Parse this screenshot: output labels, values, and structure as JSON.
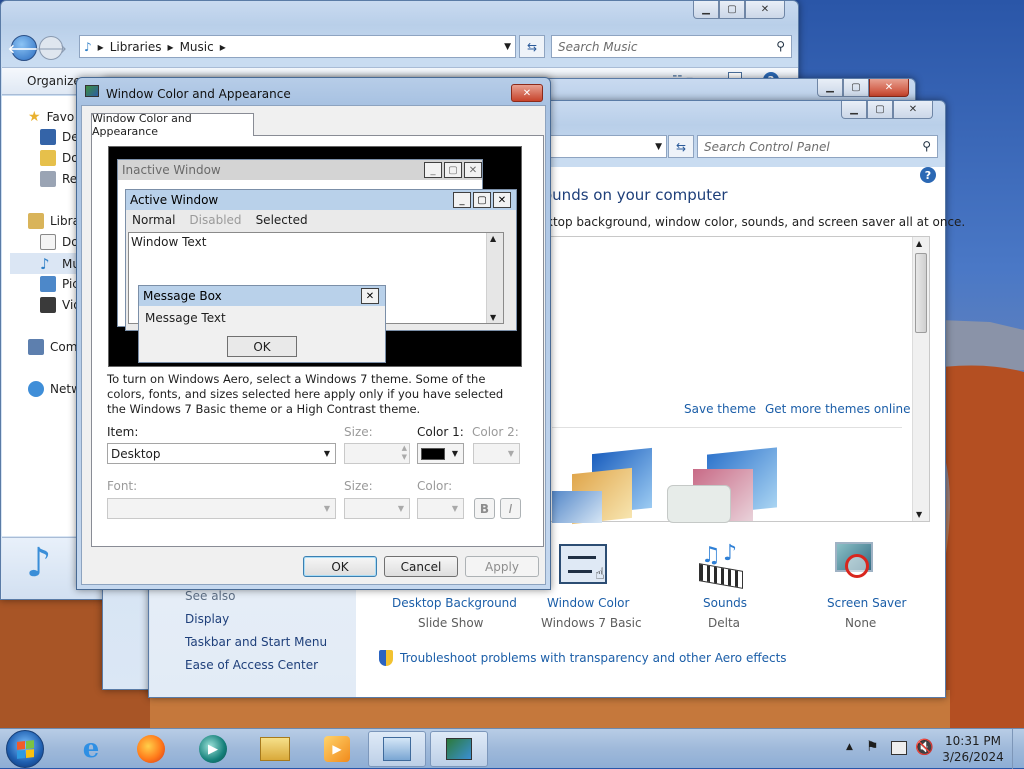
{
  "explorer": {
    "breadcrumb": [
      "Libraries",
      "Music"
    ],
    "search_placeholder": "Search Music",
    "toolbar_organize": "Organize",
    "nav": [
      {
        "label": "Favo",
        "icon": "star-icon"
      },
      {
        "label": "Des",
        "icon": "desktop-icon"
      },
      {
        "label": "Dov",
        "icon": "downloads-icon"
      },
      {
        "label": "Rec",
        "icon": "recent-places-icon"
      },
      {
        "label": "Libra",
        "icon": "libraries-icon"
      },
      {
        "label": "Doc",
        "icon": "documents-icon"
      },
      {
        "label": "Mu",
        "icon": "music-icon"
      },
      {
        "label": "Pic",
        "icon": "pictures-icon"
      },
      {
        "label": "Vid",
        "icon": "videos-icon"
      },
      {
        "label": "Com",
        "icon": "computer-icon"
      },
      {
        "label": "Netw",
        "icon": "network-icon"
      }
    ]
  },
  "control_panel": {
    "search_placeholder": "Search Control Panel",
    "heading": "ounds on your computer",
    "subheading": "ktop background, window color, sounds, and screen saver all at once.",
    "save_theme": "Save theme",
    "get_more_themes": "Get more themes online",
    "see_also": "See also",
    "side_links": [
      "Display",
      "Taskbar and Start Menu",
      "Ease of Access Center"
    ],
    "bottom_items": [
      {
        "title": "Desktop Background",
        "sub": "Slide Show",
        "icon": "desktop-background-icon"
      },
      {
        "title": "Window Color",
        "sub": "Windows 7 Basic",
        "icon": "window-color-icon"
      },
      {
        "title": "Sounds",
        "sub": "Delta",
        "icon": "sounds-icon"
      },
      {
        "title": "Screen Saver",
        "sub": "None",
        "icon": "screen-saver-icon"
      }
    ],
    "troubleshoot_link": "Troubleshoot problems with transparency and other Aero effects"
  },
  "dialog": {
    "title": "Window Color and Appearance",
    "tab": "Window Color and Appearance",
    "preview": {
      "inactive_window": "Inactive Window",
      "active_window": "Active Window",
      "menu": [
        "Normal",
        "Disabled",
        "Selected"
      ],
      "window_text": "Window Text",
      "message_box": "Message Box",
      "message_text": "Message Text",
      "ok": "OK"
    },
    "info_text": "To turn on Windows Aero, select a Windows 7 theme.  Some of the colors, fonts, and sizes selected here apply only if you have selected the Windows 7 Basic theme or a High Contrast theme.",
    "item_label": "Item:",
    "item_value": "Desktop",
    "size_label": "Size:",
    "color1_label": "Color 1:",
    "color2_label": "Color 2:",
    "font_label": "Font:",
    "size2_label": "Size:",
    "color_label": "Color:",
    "bold_btn": "B",
    "italic_btn": "I",
    "ok": "OK",
    "cancel": "Cancel",
    "apply": "Apply",
    "color1_value": "#000000"
  },
  "taskbar": {
    "time": "10:31 PM",
    "date": "3/26/2024",
    "apps": [
      "internet-explorer-icon",
      "firefox-icon",
      "media-center-icon",
      "file-explorer-icon",
      "media-player-icon",
      "control-panel-icon",
      "personalization-icon"
    ]
  }
}
